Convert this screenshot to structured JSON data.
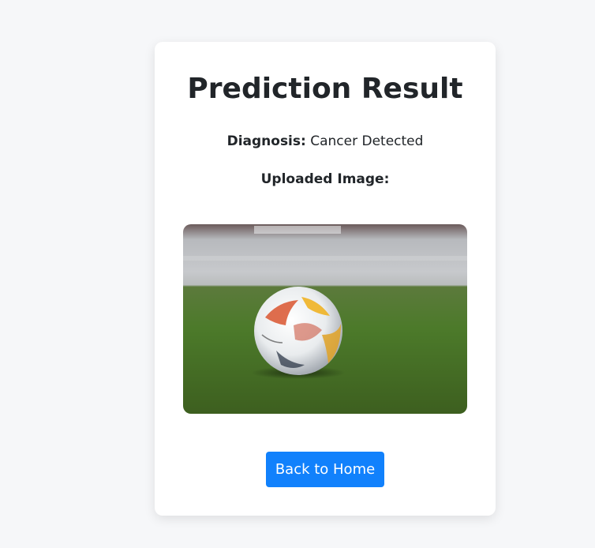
{
  "result": {
    "title": "Prediction Result",
    "diagnosis_label": "Diagnosis:",
    "diagnosis_value": "Cancer Detected",
    "uploaded_label": "Uploaded Image:",
    "image_alt": "soccer ball on grass",
    "back_button": "Back to Home"
  },
  "colors": {
    "page_background": "#f6f7f9",
    "card_background": "#ffffff",
    "button_primary": "#1181fc",
    "text": "#212529"
  }
}
